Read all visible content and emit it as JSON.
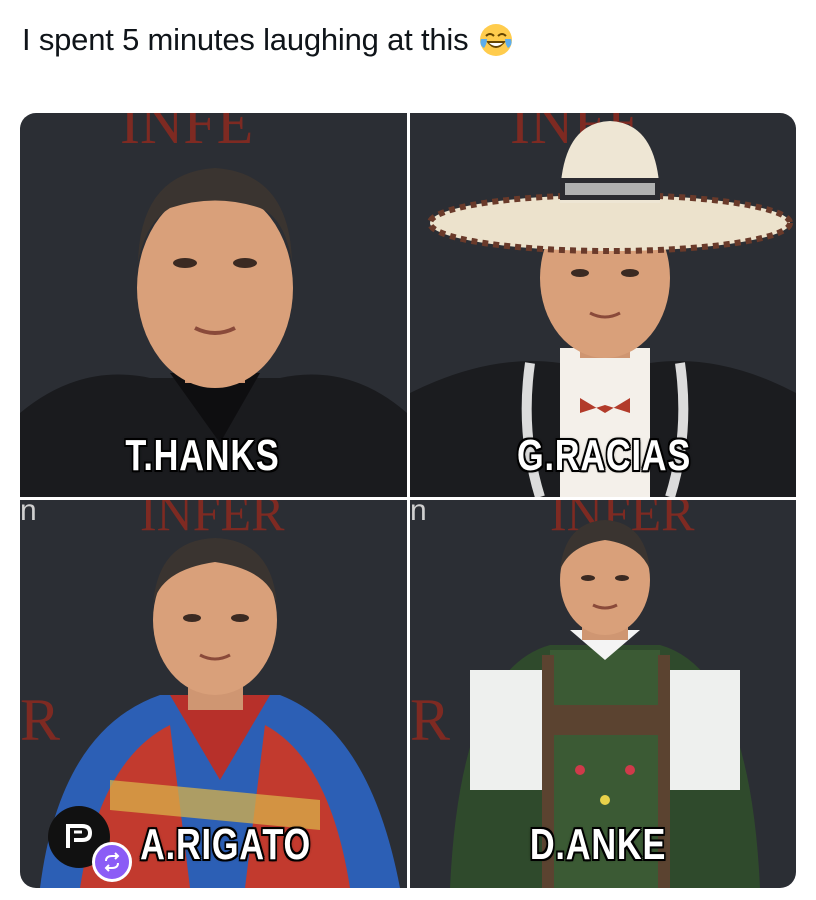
{
  "tweet": {
    "text": "I spent 5 minutes laughing at this",
    "emoji": "face-with-tears-of-joy-icon"
  },
  "panels": [
    {
      "caption": "T.HANKS"
    },
    {
      "caption": "G.RACIAS"
    },
    {
      "caption": "A.RIGATO"
    },
    {
      "caption": "D.ANKE"
    }
  ],
  "colors": {
    "backdrop": "#2a2d33",
    "backdrop_text": "#8a2a24",
    "skin": "#d9a07a",
    "caption_text": "#ffffff",
    "caption_outline": "#000000",
    "watermark_badge": "#8b5cf6"
  }
}
